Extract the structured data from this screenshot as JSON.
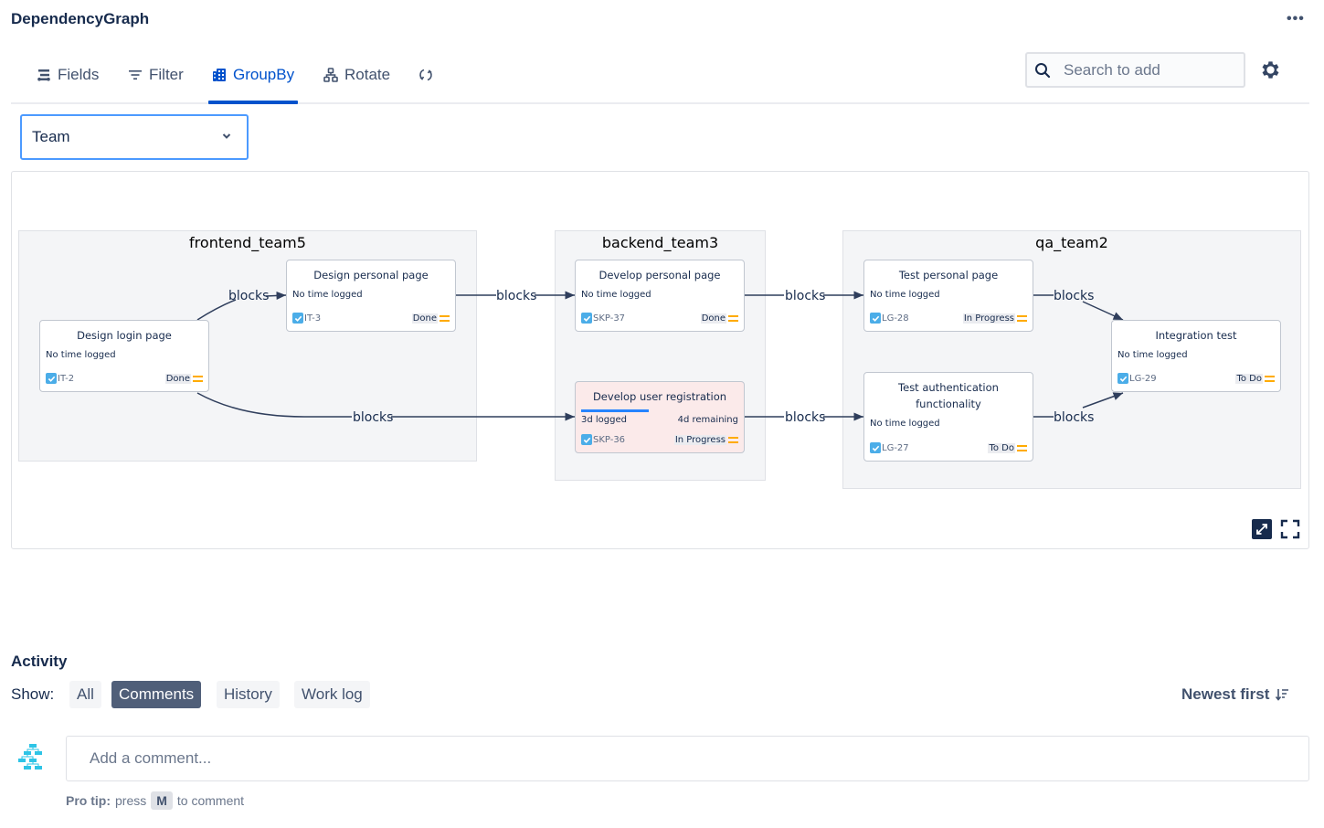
{
  "app": {
    "title": "DependencyGraph",
    "more_label": "•••"
  },
  "toolbar": {
    "tabs": [
      {
        "label": "Fields",
        "icon": "fields-icon"
      },
      {
        "label": "Filter",
        "icon": "filter-icon"
      },
      {
        "label": "GroupBy",
        "icon": "groupby-icon",
        "active": true
      },
      {
        "label": "Rotate",
        "icon": "rotate-hierarchy-icon"
      }
    ],
    "refresh_icon": "refresh-icon",
    "search_placeholder": "Search to add",
    "settings_icon": "gear-icon"
  },
  "groupby_select": {
    "value": "Team"
  },
  "graph": {
    "groups": [
      {
        "name": "frontend_team5"
      },
      {
        "name": "backend_team3"
      },
      {
        "name": "qa_team2"
      }
    ],
    "nodes": [
      {
        "id": "n1",
        "title": "Design login page",
        "time": "No time logged",
        "key": "IT-2",
        "status": "Done"
      },
      {
        "id": "n2",
        "title": "Design personal page",
        "time": "No time logged",
        "key": "IT-3",
        "status": "Done"
      },
      {
        "id": "n3",
        "title": "Develop personal page",
        "time": "No time logged",
        "key": "SKP-37",
        "status": "Done"
      },
      {
        "id": "n4",
        "title": "Develop user registration",
        "time_logged": "3d logged",
        "time_remaining": "4d remaining",
        "progress": 0.43,
        "key": "SKP-36",
        "status": "In Progress"
      },
      {
        "id": "n5",
        "title": "Test personal page",
        "time": "No time logged",
        "key": "LG-28",
        "status": "In Progress"
      },
      {
        "id": "n6",
        "title": "Test authentication functionality",
        "time": "No time logged",
        "key": "LG-27",
        "status": "To Do"
      },
      {
        "id": "n7",
        "title": "Integration test",
        "time": "No time logged",
        "key": "LG-29",
        "status": "To Do"
      }
    ],
    "edges": [
      {
        "from": "IT-2",
        "to": "IT-3",
        "label": "blocks"
      },
      {
        "from": "IT-2",
        "to": "SKP-36",
        "label": "blocks"
      },
      {
        "from": "IT-3",
        "to": "SKP-37",
        "label": "blocks"
      },
      {
        "from": "SKP-37",
        "to": "LG-28",
        "label": "blocks"
      },
      {
        "from": "SKP-36",
        "to": "LG-27",
        "label": "blocks"
      },
      {
        "from": "LG-28",
        "to": "LG-29",
        "label": "blocks"
      },
      {
        "from": "LG-27",
        "to": "LG-29",
        "label": "blocks"
      }
    ],
    "controls": {
      "fit_icon": "fit-to-view-icon",
      "fullscreen_icon": "fullscreen-icon"
    }
  },
  "activity": {
    "title": "Activity",
    "show_label": "Show:",
    "filters": [
      {
        "label": "All"
      },
      {
        "label": "Comments",
        "active": true
      },
      {
        "label": "History"
      },
      {
        "label": "Work log"
      }
    ],
    "sort_label": "Newest first",
    "comment_placeholder": "Add a comment...",
    "protip_prefix": "Pro tip:",
    "protip_press": "press",
    "protip_key": "M",
    "protip_suffix": "to comment"
  },
  "colors": {
    "accent": "#0052cc",
    "priority": "#ffab00",
    "issue_check": "#4bade8",
    "progress": "#2684ff"
  }
}
